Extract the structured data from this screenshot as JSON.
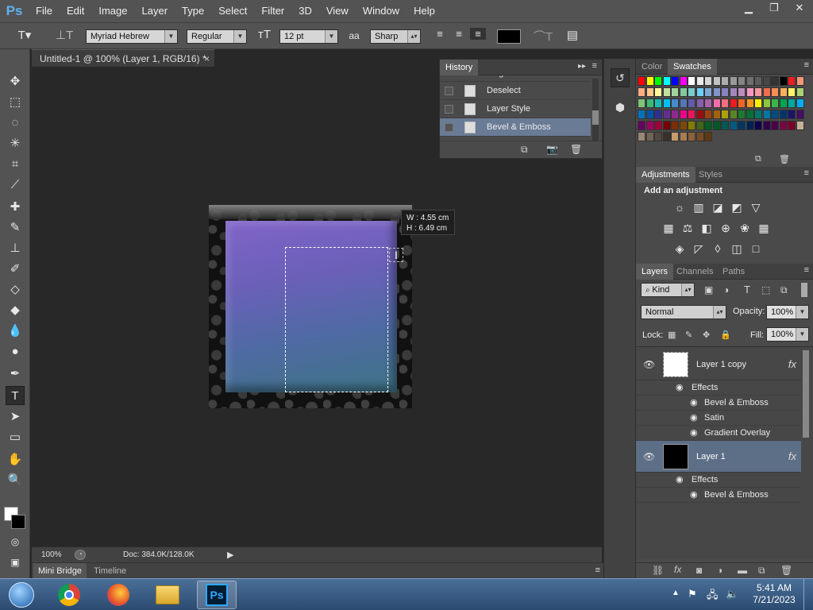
{
  "app": {
    "logo": "Ps"
  },
  "menu": [
    "File",
    "Edit",
    "Image",
    "Layer",
    "Type",
    "Select",
    "Filter",
    "3D",
    "View",
    "Window",
    "Help"
  ],
  "window_controls": {
    "minimize": "▁",
    "restore": "❐",
    "close": "✕"
  },
  "options": {
    "font_family": "Myriad Hebrew",
    "font_style": "Regular",
    "font_size": "12 pt",
    "anti_alias_icon": "aa",
    "anti_alias": "Sharp",
    "text_color": "#000000"
  },
  "document": {
    "tab_title": "Untitled-1 @ 100% (Layer 1, RGB/16) *",
    "close": "×",
    "dimensions": {
      "w": "W :  4.55 cm",
      "h": "H :  6.49 cm"
    }
  },
  "status": {
    "zoom": "100%",
    "doc": "Doc: 384.0K/128.0K"
  },
  "bottom_tabs": [
    "Mini Bridge",
    "Timeline"
  ],
  "history": {
    "tab": "History",
    "items": [
      {
        "label": "Magic Wand",
        "active": false
      },
      {
        "label": "Deselect",
        "active": false
      },
      {
        "label": "Layer Style",
        "active": false
      },
      {
        "label": "Bevel & Emboss",
        "active": true
      }
    ]
  },
  "color_panel": {
    "tabs": [
      "Color",
      "Swatches"
    ],
    "swatches": [
      "#ff0000",
      "#ffff00",
      "#00ff00",
      "#00ffff",
      "#0000ff",
      "#ff00ff",
      "#ffffff",
      "#ebebeb",
      "#d6d6d6",
      "#c2c2c2",
      "#adadad",
      "#999999",
      "#858585",
      "#707070",
      "#5c5c5c",
      "#474747",
      "#333333",
      "#000000",
      "#ed1c24",
      "#f7977a",
      "#f9ad81",
      "#fdc68a",
      "#fff79a",
      "#c4df9b",
      "#a3d39c",
      "#82ca9d",
      "#7bcdc8",
      "#6ecff6",
      "#7ea7d8",
      "#8493ca",
      "#8882be",
      "#a187be",
      "#bc8cbf",
      "#f49ac2",
      "#f6989d",
      "#f26c4f",
      "#f68e55",
      "#fbaf5c",
      "#fff467",
      "#acd372",
      "#7cc576",
      "#3bb878",
      "#1abbb4",
      "#00bff3",
      "#438ccb",
      "#5574b9",
      "#605ca8",
      "#855fa8",
      "#a763a8",
      "#f06ea9",
      "#f26d7d",
      "#ed1c24",
      "#f26522",
      "#f7941d",
      "#fff200",
      "#8dc73f",
      "#39b54a",
      "#00a651",
      "#00a99d",
      "#00aeef",
      "#0072bc",
      "#0054a6",
      "#2e3192",
      "#662d91",
      "#92278f",
      "#ec008c",
      "#ed145b",
      "#9e0b0f",
      "#a0410d",
      "#a36209",
      "#aba000",
      "#598527",
      "#197b30",
      "#007236",
      "#00746b",
      "#0076a3",
      "#004b80",
      "#003471",
      "#1b1464",
      "#440e62",
      "#630460",
      "#9e005d",
      "#9e0039",
      "#790000",
      "#7b2e00",
      "#7d4900",
      "#827b00",
      "#406618",
      "#005e20",
      "#005826",
      "#005952",
      "#005b7f",
      "#003663",
      "#002157",
      "#0d004c",
      "#32004b",
      "#4b0049",
      "#7b0046",
      "#7a0026",
      "#c7b299",
      "#998675",
      "#736357",
      "#534741",
      "#37302d",
      "#c69c6d",
      "#a67c52",
      "#8c6239",
      "#754c24",
      "#603913"
    ]
  },
  "adjustments": {
    "tabs": [
      "Adjustments",
      "Styles"
    ],
    "title": "Add an adjustment",
    "icons": [
      "☼",
      "▥",
      "◪",
      "◩",
      "▽",
      "▦",
      "⚖",
      "◧",
      "⊕",
      "❀",
      "▦",
      "◈",
      "◸",
      "◊",
      "◫",
      "□"
    ]
  },
  "layers": {
    "tabs": [
      "Layers",
      "Channels",
      "Paths"
    ],
    "filter": "Kind",
    "blend_mode": "Normal",
    "opacity_label": "Opacity:",
    "opacity": "100%",
    "lock_label": "Lock:",
    "fill_label": "Fill:",
    "fill": "100%",
    "items": [
      {
        "name": "Layer 1 copy",
        "thumb": "#ffffff",
        "active": false,
        "effects_label": "Effects",
        "effects": [
          "Bevel & Emboss",
          "Satin",
          "Gradient Overlay"
        ]
      },
      {
        "name": "Layer 1",
        "thumb": "#000000",
        "active": true,
        "effects_label": "Effects",
        "effects": [
          "Bevel & Emboss"
        ]
      }
    ],
    "fx": "fx"
  },
  "taskbar": {
    "time": "5:41 AM",
    "date": "7/21/2023",
    "ps_label": "Ps"
  }
}
